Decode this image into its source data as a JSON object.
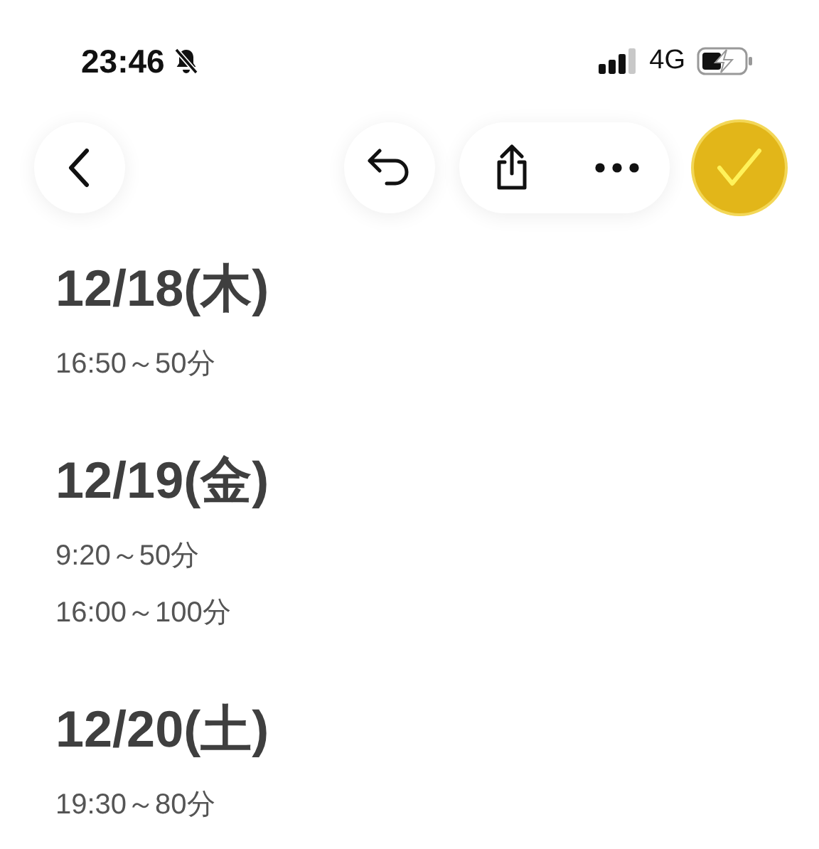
{
  "status_bar": {
    "time": "23:46",
    "network": "4G"
  },
  "days": [
    {
      "date": "12/18(木)",
      "slots": [
        "16:50～50分"
      ]
    },
    {
      "date": "12/19(金)",
      "slots": [
        "9:20～50分",
        "16:00～100分"
      ]
    },
    {
      "date": "12/20(土)",
      "slots": [
        "19:30～80分"
      ]
    }
  ]
}
